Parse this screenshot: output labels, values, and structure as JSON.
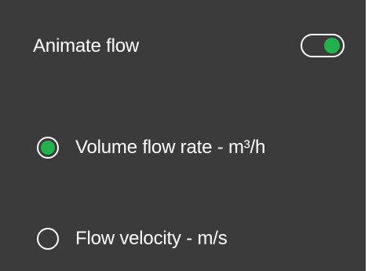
{
  "settings": {
    "animate_flow": {
      "label": "Animate flow",
      "enabled": true
    },
    "flow_display": {
      "selected": "volume_flow_rate",
      "options": [
        {
          "id": "volume_flow_rate",
          "label": "Volume flow rate - m³/h"
        },
        {
          "id": "flow_velocity",
          "label": "Flow velocity - m/s"
        }
      ]
    }
  },
  "colors": {
    "panel_background": "#3b3b3b",
    "accent_green": "#22b14c",
    "text": "#ffffff"
  }
}
